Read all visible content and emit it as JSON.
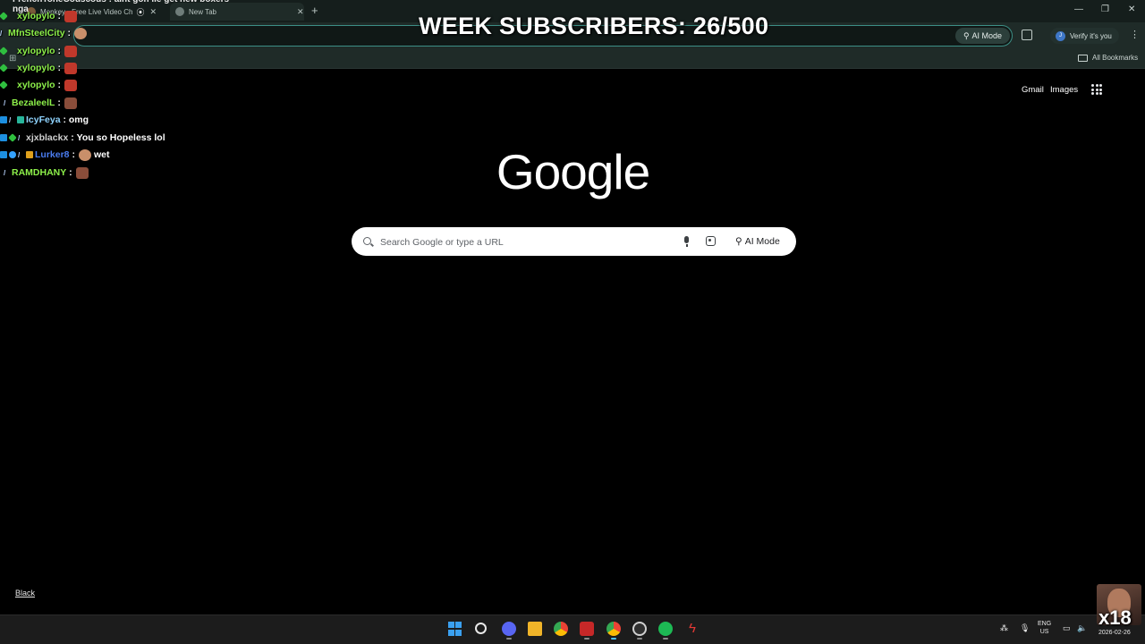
{
  "browser": {
    "tabs": [
      {
        "title": "Monkey - Free Live Video Ch"
      },
      {
        "title": "New Tab"
      }
    ],
    "omnibox": {
      "ai_mode_label": "AI Mode"
    },
    "profile": {
      "verify_label": "Verify it's you",
      "avatar_letter": "J"
    },
    "bookmarks": {
      "all_bookmarks_label": "All Bookmarks"
    }
  },
  "overlay": {
    "subs_counter": "WEEK SUBSCRIBERS: 26/500",
    "webcam_badge": "x18"
  },
  "chat": {
    "cut_top_line": "FrenchToneCouscous : aint gon lie get new boxers nga",
    "messages": [
      {
        "user": "xylopylo",
        "user_color": "#8df04a",
        "text": "",
        "emote": "em-red"
      },
      {
        "user": "MfnSteelCity",
        "user_color": "#8df04a",
        "text": "",
        "emote": "em-face"
      },
      {
        "user": "xylopylo",
        "user_color": "#8df04a",
        "text": "",
        "emote": "em-red"
      },
      {
        "user": "xylopylo",
        "user_color": "#8df04a",
        "text": "",
        "emote": "em-red"
      },
      {
        "user": "xylopylo",
        "user_color": "#8df04a",
        "text": "",
        "emote": "em-red"
      },
      {
        "user": "BezaleelL",
        "user_color": "#8df04a",
        "text": "",
        "emote": "em-brown"
      },
      {
        "user": "IcyFeya",
        "user_color": "#8fd4ff",
        "text": "omg",
        "emote": ""
      },
      {
        "user": "xjxblackx",
        "user_color": "#cfcfcf",
        "text": "You so Hopeless lol",
        "emote": ""
      },
      {
        "user": "Lurker8",
        "user_color": "#4a7cf0",
        "text": "wet",
        "emote": "em-face"
      },
      {
        "user": "RAMDHANY",
        "user_color": "#8df04a",
        "text": "",
        "emote": "em-brown"
      }
    ]
  },
  "ntp": {
    "logo": "Google",
    "search_placeholder": "Search Google or type a URL",
    "ai_mode_label": "AI Mode",
    "gmail": "Gmail",
    "images": "Images",
    "bottom_link": "Black"
  },
  "taskbar": {
    "lang_line1": "ENG",
    "lang_line2": "US",
    "date": "2026-02-26"
  }
}
